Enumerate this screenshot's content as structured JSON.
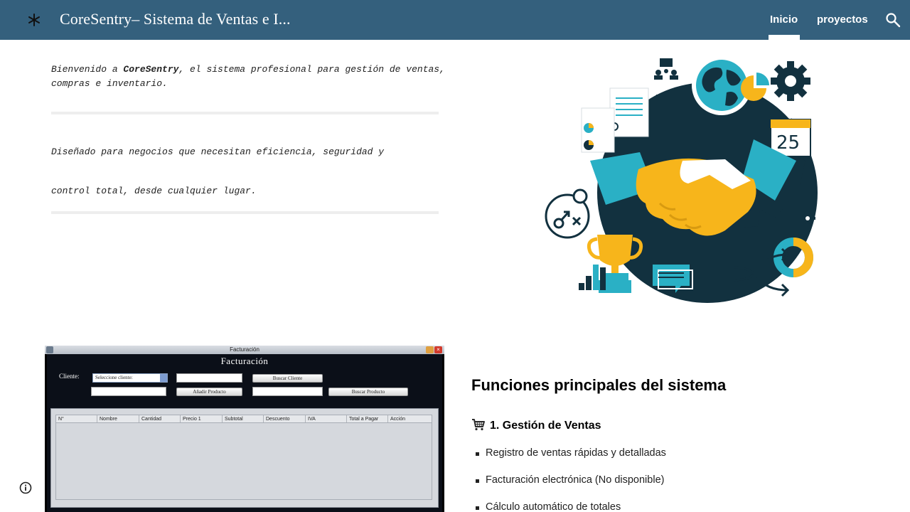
{
  "header": {
    "title": "CoreSentry– Sistema de Ventas e I...",
    "nav": [
      {
        "label": "Inicio",
        "active": true
      },
      {
        "label": "proyectos",
        "active": false
      }
    ]
  },
  "intro": {
    "welcome_prefix": "Bienvenido a ",
    "brand": "CoreSentry",
    "welcome_suffix": ", el sistema profesional para gestión de ventas, compras e inventario.",
    "line2": "Diseñado para negocios que necesitan eficiencia, seguridad y",
    "line3": "control total, desde cualquier lugar."
  },
  "illustration": {
    "calendar_day": "25"
  },
  "app_screenshot": {
    "window_title": "Facturación",
    "heading": "Facturación",
    "client_label": "Cliente:",
    "client_select": "Seleccione cliente:",
    "btn_buscar_cliente": "Buscar Cliente",
    "btn_anadir_producto": "Añadir Producto",
    "btn_buscar_producto": "Buscar Producto",
    "columns": [
      "N°",
      "Nombre",
      "Cantidad",
      "Precio 1",
      "Subtotal",
      "Descuento",
      "IVA",
      "Total a Pagar",
      "Acción"
    ]
  },
  "features": {
    "title": "Funciones principales del sistema",
    "section1": "1. Gestión de Ventas",
    "items": [
      "Registro de ventas rápidas y detalladas",
      "Facturación electrónica (No disponible)",
      "Cálculo automático de totales"
    ]
  },
  "colors": {
    "header_bg": "#34607d",
    "teal": "#2ab0c5",
    "navy": "#12313f",
    "yellow": "#f7b51b"
  }
}
